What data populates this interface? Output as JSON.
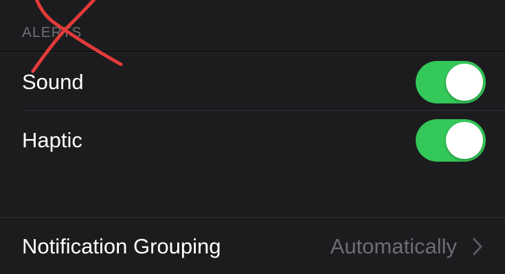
{
  "alerts_section": {
    "header": "ALERTS",
    "rows": [
      {
        "label": "Sound",
        "toggle_on": true
      },
      {
        "label": "Haptic",
        "toggle_on": true
      }
    ]
  },
  "grouping_section": {
    "label": "Notification Grouping",
    "value": "Automatically",
    "icon": "chevron-right-icon"
  },
  "colors": {
    "toggle_on": "#34c759",
    "background": "#1c1c1e",
    "annotation": "#e23a3a"
  }
}
